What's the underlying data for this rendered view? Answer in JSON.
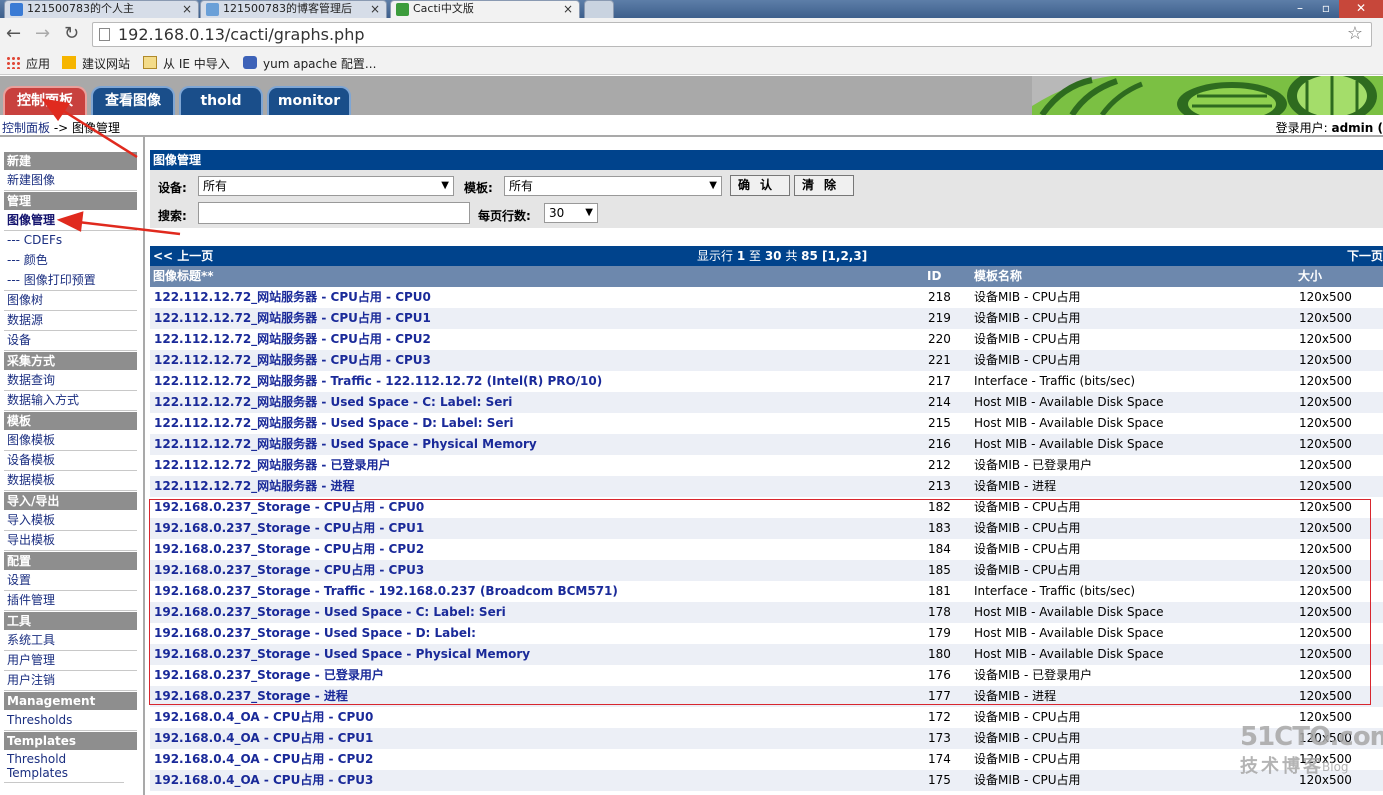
{
  "browser": {
    "tabs": [
      {
        "title": "121500783的个人主",
        "icon": "home-favicon",
        "active": false
      },
      {
        "title": "121500783的博客管理后",
        "icon": "blog-favicon",
        "active": false
      },
      {
        "title": "Cacti中文版",
        "icon": "cacti-favicon",
        "active": true
      }
    ],
    "address": "192.168.0.13/cacti/graphs.php",
    "bookmarks": [
      {
        "label": "应用",
        "icon": "apps-grid-icon"
      },
      {
        "label": "建议网站",
        "icon": "bing-icon"
      },
      {
        "label": "从 IE 中导入",
        "icon": "folder-icon"
      },
      {
        "label": "yum apache 配置...",
        "icon": "paw-icon"
      }
    ]
  },
  "cacti": {
    "tabs": [
      "控制面板",
      "查看图像",
      "thold",
      "monitor"
    ],
    "breadcrumb": {
      "home": "控制面板",
      "separator": " -> ",
      "current": "图像管理"
    },
    "login_label": "登录用户: ",
    "login_user": "admin ("
  },
  "sidebar": {
    "sections": [
      {
        "head": "新建",
        "items": [
          {
            "label": "新建图像"
          }
        ]
      },
      {
        "head": "管理",
        "items": [
          {
            "label": "图像管理",
            "active": true
          },
          {
            "label": "--- CDEFs"
          },
          {
            "label": "--- 颜色"
          },
          {
            "label": "--- 图像打印预置"
          },
          {
            "label": "图像树"
          },
          {
            "label": "数据源"
          },
          {
            "label": "设备"
          }
        ]
      },
      {
        "head": "采集方式",
        "items": [
          {
            "label": "数据查询"
          },
          {
            "label": "数据输入方式"
          }
        ]
      },
      {
        "head": "模板",
        "items": [
          {
            "label": "图像模板"
          },
          {
            "label": "设备模板"
          },
          {
            "label": "数据模板"
          }
        ]
      },
      {
        "head": "导入/导出",
        "items": [
          {
            "label": "导入模板"
          },
          {
            "label": "导出模板"
          }
        ]
      },
      {
        "head": "配置",
        "items": [
          {
            "label": "设置"
          },
          {
            "label": "插件管理"
          }
        ]
      },
      {
        "head": "工具",
        "items": [
          {
            "label": "系统工具"
          },
          {
            "label": "用户管理"
          },
          {
            "label": "用户注销"
          }
        ]
      },
      {
        "head": "Management",
        "items": [
          {
            "label": "Thresholds"
          }
        ]
      },
      {
        "head": "Templates",
        "items": [
          {
            "label": "Threshold Templates"
          }
        ]
      }
    ]
  },
  "filter": {
    "title": "图像管理",
    "device_label": "设备:",
    "device_value": "所有",
    "template_label": "模板:",
    "template_value": "所有",
    "confirm_button": "确认",
    "clear_button": "清除",
    "search_label": "搜索:",
    "search_value": "",
    "rows_label": "每页行数:",
    "rows_value": "30"
  },
  "pager": {
    "prev": "<< 上一页",
    "info_prefix": "显示行 ",
    "info_from": "1",
    "info_mid1": " 至 ",
    "info_to": "30",
    "info_mid2": " 共 ",
    "info_total": "85",
    "info_pages": " [1,2,3]",
    "next": "下一页"
  },
  "table": {
    "columns": [
      "图像标题**",
      "ID",
      "模板名称",
      "大小"
    ],
    "rows": [
      {
        "title": "122.112.12.72_网站服务器 - CPU占用 - CPU0",
        "id": "218",
        "template": "设备MIB - CPU占用",
        "size": "120x500"
      },
      {
        "title": "122.112.12.72_网站服务器 - CPU占用 - CPU1",
        "id": "219",
        "template": "设备MIB - CPU占用",
        "size": "120x500"
      },
      {
        "title": "122.112.12.72_网站服务器 - CPU占用 - CPU2",
        "id": "220",
        "template": "设备MIB - CPU占用",
        "size": "120x500"
      },
      {
        "title": "122.112.12.72_网站服务器 - CPU占用 - CPU3",
        "id": "221",
        "template": "设备MIB - CPU占用",
        "size": "120x500"
      },
      {
        "title": "122.112.12.72_网站服务器 - Traffic - 122.112.12.72 (Intel(R) PRO/10)",
        "id": "217",
        "template": "Interface - Traffic (bits/sec)",
        "size": "120x500"
      },
      {
        "title": "122.112.12.72_网站服务器 - Used Space - C: Label: Seri",
        "id": "214",
        "template": "Host MIB - Available Disk Space",
        "size": "120x500"
      },
      {
        "title": "122.112.12.72_网站服务器 - Used Space - D: Label: Seri",
        "id": "215",
        "template": "Host MIB - Available Disk Space",
        "size": "120x500"
      },
      {
        "title": "122.112.12.72_网站服务器 - Used Space - Physical Memory",
        "id": "216",
        "template": "Host MIB - Available Disk Space",
        "size": "120x500"
      },
      {
        "title": "122.112.12.72_网站服务器 - 已登录用户",
        "id": "212",
        "template": "设备MIB - 已登录用户",
        "size": "120x500"
      },
      {
        "title": "122.112.12.72_网站服务器 - 进程",
        "id": "213",
        "template": "设备MIB - 进程",
        "size": "120x500"
      },
      {
        "title": "192.168.0.237_Storage - CPU占用 - CPU0",
        "id": "182",
        "template": "设备MIB - CPU占用",
        "size": "120x500"
      },
      {
        "title": "192.168.0.237_Storage - CPU占用 - CPU1",
        "id": "183",
        "template": "设备MIB - CPU占用",
        "size": "120x500"
      },
      {
        "title": "192.168.0.237_Storage - CPU占用 - CPU2",
        "id": "184",
        "template": "设备MIB - CPU占用",
        "size": "120x500"
      },
      {
        "title": "192.168.0.237_Storage - CPU占用 - CPU3",
        "id": "185",
        "template": "设备MIB - CPU占用",
        "size": "120x500"
      },
      {
        "title": "192.168.0.237_Storage - Traffic - 192.168.0.237 (Broadcom BCM571)",
        "id": "181",
        "template": "Interface - Traffic (bits/sec)",
        "size": "120x500"
      },
      {
        "title": "192.168.0.237_Storage - Used Space - C: Label: Seri",
        "id": "178",
        "template": "Host MIB - Available Disk Space",
        "size": "120x500"
      },
      {
        "title": "192.168.0.237_Storage - Used Space - D: Label:",
        "id": "179",
        "template": "Host MIB - Available Disk Space",
        "size": "120x500"
      },
      {
        "title": "192.168.0.237_Storage - Used Space - Physical Memory",
        "id": "180",
        "template": "Host MIB - Available Disk Space",
        "size": "120x500"
      },
      {
        "title": "192.168.0.237_Storage - 已登录用户",
        "id": "176",
        "template": "设备MIB - 已登录用户",
        "size": "120x500"
      },
      {
        "title": "192.168.0.237_Storage - 进程",
        "id": "177",
        "template": "设备MIB - 进程",
        "size": "120x500"
      },
      {
        "title": "192.168.0.4_OA - CPU占用 - CPU0",
        "id": "172",
        "template": "设备MIB - CPU占用",
        "size": "120x500"
      },
      {
        "title": "192.168.0.4_OA - CPU占用 - CPU1",
        "id": "173",
        "template": "设备MIB - CPU占用",
        "size": "120x500"
      },
      {
        "title": "192.168.0.4_OA - CPU占用 - CPU2",
        "id": "174",
        "template": "设备MIB - CPU占用",
        "size": "120x500"
      },
      {
        "title": "192.168.0.4_OA - CPU占用 - CPU3",
        "id": "175",
        "template": "设备MIB - CPU占用",
        "size": "120x500"
      }
    ]
  },
  "watermark": {
    "site": "51CTO.com",
    "subtitle": "技术博客",
    "tag": "Blog"
  },
  "colors": {
    "header_blue": "#00438c",
    "column_header": "#6d88ad",
    "menu_head": "#8e8e8e",
    "highlight": "#d8262e",
    "active_tab": "#c8413e"
  }
}
